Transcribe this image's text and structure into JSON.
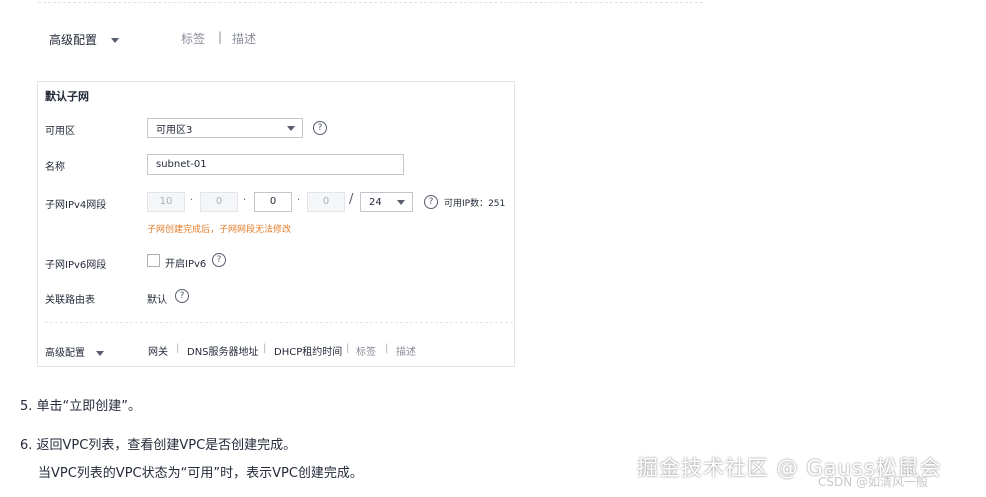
{
  "top": {
    "advanced_label": "高级配置",
    "tab_tags": "标签",
    "separator": "|",
    "tab_desc": "描述"
  },
  "card": {
    "title": "默认子网",
    "az_label": "可用区",
    "az_value": "可用区3",
    "name_label": "名称",
    "name_value": "subnet-01",
    "ipv4_label": "子网IPv4网段",
    "ip_octets": [
      "10",
      "0",
      "0",
      "0"
    ],
    "ip_dot": "·",
    "ip_slash": "/",
    "mask_value": "24",
    "available_ip_text": "可用IP数：251",
    "ipv4_note": "子网创建完成后，子网网段无法修改",
    "ipv6_label": "子网IPv6网段",
    "ipv6_checkbox_label": "开启IPv6",
    "route_label": "关联路由表",
    "route_value": "默认",
    "advanced_label": "高级配置",
    "adv_links": [
      "网关",
      "DNS服务器地址",
      "DHCP租约时间",
      "标签",
      "描述"
    ],
    "separator": "|"
  },
  "steps": {
    "step5": "5. 单击“立即创建”。",
    "step6": "6. 返回VPC列表，查看创建VPC是否创建完成。",
    "step6_detail": "当VPC列表的VPC状态为“可用”时，表示VPC创建完成。"
  },
  "watermark": {
    "main": "掘金技术社区 @ Gauss松鼠会",
    "sub": "CSDN @如清风一般"
  },
  "colors": {
    "note_orange": "#e37d29",
    "text_dark": "#252b3a",
    "text_grey": "#8a8e99"
  },
  "icons": [
    "help-icon",
    "chevron-down-icon",
    "checkbox-icon"
  ]
}
